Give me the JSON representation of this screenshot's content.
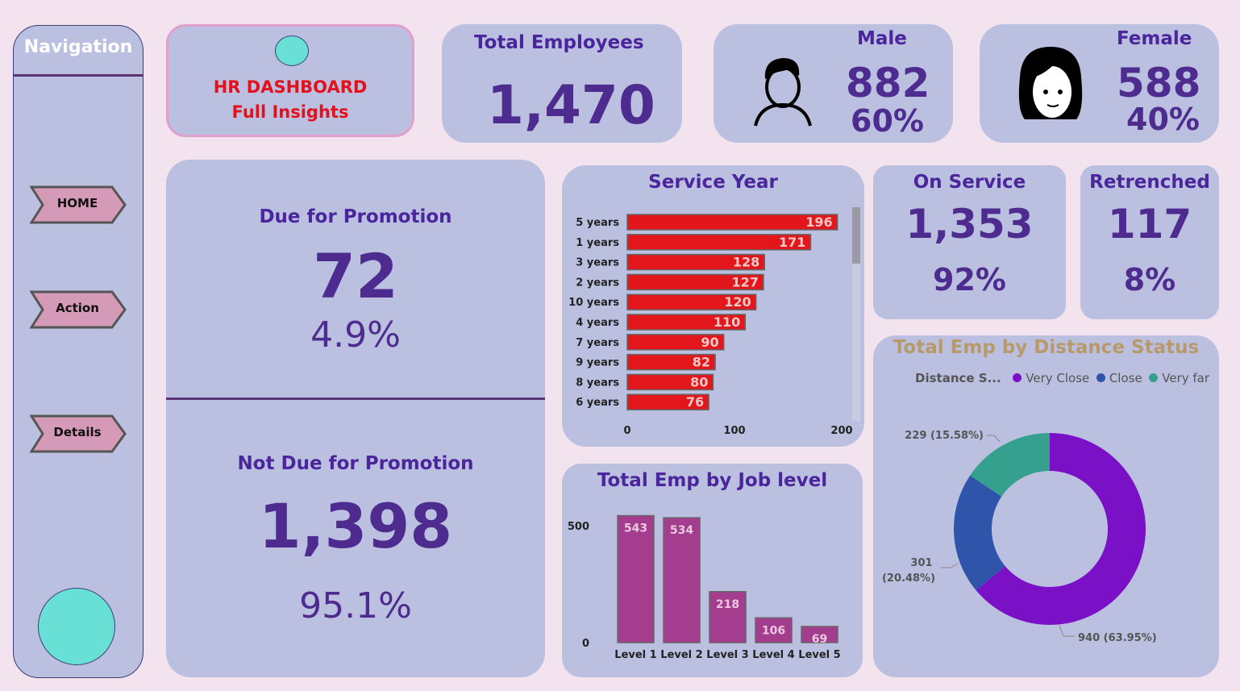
{
  "nav": {
    "title": "Navigation",
    "buttons": [
      {
        "label": "HOME"
      },
      {
        "label": "Action"
      },
      {
        "label": "Details"
      }
    ]
  },
  "header": {
    "line1": "HR DASHBOARD",
    "line2": "Full Insights"
  },
  "total_employees": {
    "label": "Total Employees",
    "value": "1,470"
  },
  "male": {
    "label": "Male",
    "value": "882",
    "percent": "60%"
  },
  "female": {
    "label": "Female",
    "value": "588",
    "percent": "40%"
  },
  "promotion": {
    "due_label": "Due for Promotion",
    "due_value": "72",
    "due_percent": "4.9%",
    "not_due_label": "Not Due for Promotion",
    "not_due_value": "1,398",
    "not_due_percent": "95.1%"
  },
  "on_service": {
    "label": "On Service",
    "value": "1,353",
    "percent": "92%"
  },
  "retrenched": {
    "label": "Retrenched",
    "value": "117",
    "percent": "8%"
  },
  "colors": {
    "bar_red": "#e3161b",
    "job_bar": "#a43d8e",
    "very_close": "#7b11c6",
    "close": "#2f55aa",
    "very_far": "#35a08e"
  },
  "chart_data": [
    {
      "type": "bar",
      "orientation": "horizontal",
      "title": "Service Year",
      "categories": [
        "5 years",
        "1 years",
        "3 years",
        "2 years",
        "10 years",
        "4 years",
        "7 years",
        "9 years",
        "8 years",
        "6 years"
      ],
      "values": [
        196,
        171,
        128,
        127,
        120,
        110,
        90,
        82,
        80,
        76
      ],
      "xticks": [
        "0",
        "100",
        "200"
      ],
      "xlim": [
        0,
        200
      ]
    },
    {
      "type": "bar",
      "title": "Total Emp by Job level",
      "categories": [
        "Level 1",
        "Level 2",
        "Level 3",
        "Level 4",
        "Level 5"
      ],
      "values": [
        543,
        534,
        218,
        106,
        69
      ],
      "yticks": [
        "0",
        "500"
      ],
      "ylim": [
        0,
        560
      ]
    },
    {
      "type": "pie",
      "title": "Total Emp by Distance Status",
      "legend_title": "Distance S...",
      "legend_position": "top",
      "categories": [
        "Very Close",
        "Close",
        "Very far"
      ],
      "values": [
        940,
        301,
        229
      ],
      "labels": [
        "940 (63.95%)",
        "301 (20.48%)",
        "229 (15.58%)"
      ]
    }
  ]
}
